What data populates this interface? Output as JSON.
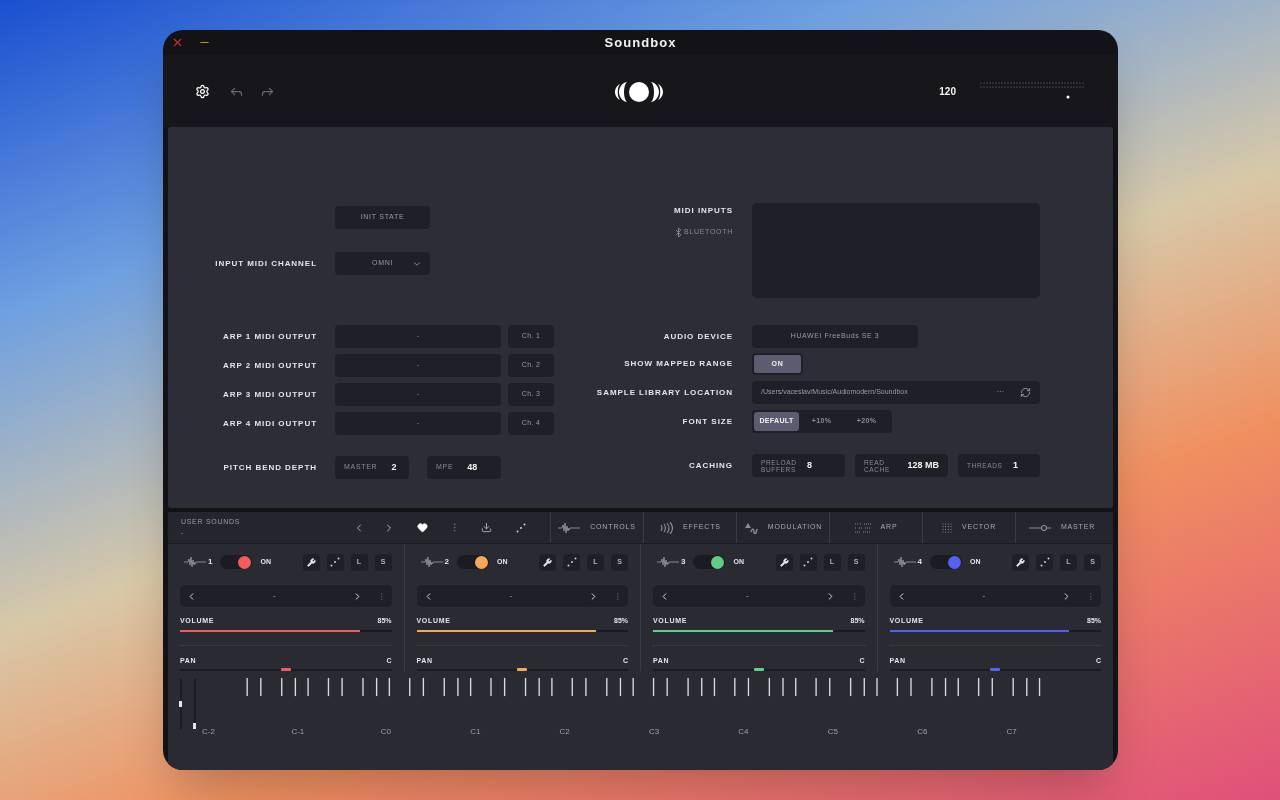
{
  "window": {
    "title": "Soundbox"
  },
  "header": {
    "tempo": "120"
  },
  "settings": {
    "init_button": "INIT STATE",
    "input_midi_channel": {
      "label": "INPUT MIDI CHANNEL",
      "value": "OMNI"
    },
    "arp_outputs": [
      {
        "label": "ARP 1 MIDI OUTPUT",
        "device": "-",
        "channel": "Ch. 1"
      },
      {
        "label": "ARP 2 MIDI OUTPUT",
        "device": "-",
        "channel": "Ch. 2"
      },
      {
        "label": "ARP 3 MIDI OUTPUT",
        "device": "-",
        "channel": "Ch. 3"
      },
      {
        "label": "ARP 4 MIDI OUTPUT",
        "device": "-",
        "channel": "Ch. 4"
      }
    ],
    "pitch_bend": {
      "label": "PITCH BEND DEPTH",
      "fields": [
        {
          "label": "MASTER",
          "value": "2"
        },
        {
          "label": "MPE",
          "value": "48"
        }
      ]
    },
    "midi_inputs": {
      "label": "MIDI INPUTS",
      "bluetooth": "BLUETOOTH"
    },
    "audio_device": {
      "label": "AUDIO DEVICE",
      "value": "HUAWEI FreeBuds SE 3"
    },
    "show_mapped_range": {
      "label": "SHOW MAPPED RANGE",
      "text": "ON",
      "on": true
    },
    "sample_library": {
      "label": "SAMPLE LIBRARY LOCATION",
      "path": "/Users/vaceslav/Music/Audiomodern/Soundbox",
      "more": "···"
    },
    "font_size": {
      "label": "FONT SIZE",
      "options": [
        {
          "label": "DEFAULT",
          "selected": true
        },
        {
          "label": "+10%",
          "selected": false
        },
        {
          "label": "+20%",
          "selected": false
        }
      ]
    },
    "caching": {
      "label": "CACHING",
      "fields": [
        {
          "label": "PRELOAD BUFFERS",
          "value": "8"
        },
        {
          "label": "READ CACHE",
          "value": "128 MB"
        },
        {
          "label": "THREADS",
          "value": "1"
        }
      ]
    }
  },
  "toolbar": {
    "title": "USER SOUNDS",
    "preset": "-",
    "tabs": [
      {
        "label": "CONTROLS",
        "kind": "controls"
      },
      {
        "label": "EFFECTS",
        "kind": "effects"
      },
      {
        "label": "MODULATION",
        "kind": "modulation"
      },
      {
        "label": "ARP",
        "kind": "arp"
      },
      {
        "label": "VECTOR",
        "kind": "vector"
      },
      {
        "label": "MASTER",
        "kind": "master"
      }
    ]
  },
  "channels": [
    {
      "number": "1",
      "color": "#f25c5c",
      "on": true,
      "on_label": "ON",
      "l": "L",
      "s": "S",
      "preset": "-",
      "volume": {
        "label": "VOLUME",
        "reading": "85%",
        "level": 0.85
      },
      "pan": {
        "label": "PAN",
        "reading": "C",
        "level": 0.5
      }
    },
    {
      "number": "2",
      "color": "#f6a85a",
      "on": true,
      "on_label": "ON",
      "l": "L",
      "s": "S",
      "preset": "-",
      "volume": {
        "label": "VOLUME",
        "reading": "85%",
        "level": 0.85
      },
      "pan": {
        "label": "PAN",
        "reading": "C",
        "level": 0.5
      }
    },
    {
      "number": "3",
      "color": "#5fcf85",
      "on": true,
      "on_label": "ON",
      "l": "L",
      "s": "S",
      "preset": "-",
      "volume": {
        "label": "VOLUME",
        "reading": "85%",
        "level": 0.85
      },
      "pan": {
        "label": "PAN",
        "reading": "C",
        "level": 0.5
      }
    },
    {
      "number": "4",
      "color": "#5460f0",
      "on": true,
      "on_label": "ON",
      "l": "L",
      "s": "S",
      "preset": "-",
      "volume": {
        "label": "VOLUME",
        "reading": "85%",
        "level": 0.85
      },
      "pan": {
        "label": "PAN",
        "reading": "C",
        "level": 0.5
      }
    }
  ],
  "keyboard": {
    "wheels": [
      {
        "level": 0.5
      },
      {
        "level": 0
      }
    ],
    "octaves": [
      "C-2",
      "C-1",
      "C0",
      "C1",
      "C2",
      "C3",
      "C4",
      "C5",
      "C6",
      "C7"
    ]
  }
}
